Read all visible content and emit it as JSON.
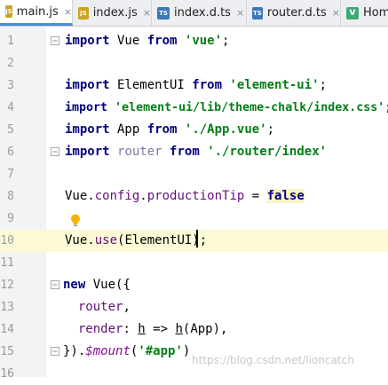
{
  "tabs": [
    {
      "label": "main.js",
      "icon": "js-file-icon",
      "badge": "JS",
      "active": true
    },
    {
      "label": "index.js",
      "icon": "js-file-icon",
      "badge": "JS",
      "active": false
    },
    {
      "label": "index.d.ts",
      "icon": "ts-file-icon",
      "badge": "TS",
      "active": false
    },
    {
      "label": "router.d.ts",
      "icon": "ts-file-icon",
      "badge": "TS",
      "active": false
    },
    {
      "label": "Hom",
      "icon": "vue-file-icon",
      "badge": "V",
      "active": false
    }
  ],
  "close_glyph": "×",
  "lines": [
    {
      "num": "1"
    },
    {
      "num": "2"
    },
    {
      "num": "3"
    },
    {
      "num": "4"
    },
    {
      "num": "5"
    },
    {
      "num": "6"
    },
    {
      "num": "7"
    },
    {
      "num": "8"
    },
    {
      "num": "9"
    },
    {
      "num": "10"
    },
    {
      "num": "11"
    },
    {
      "num": "12"
    },
    {
      "num": "13"
    },
    {
      "num": "14"
    },
    {
      "num": "15"
    },
    {
      "num": "16"
    }
  ],
  "code": {
    "l1": {
      "k1": "import",
      "t1": " Vue ",
      "k2": "from",
      "t2": " ",
      "s1": "'vue'",
      "t3": ";"
    },
    "l3": {
      "k1": "import",
      "t1": " ElementUI ",
      "k2": "from",
      "t2": " ",
      "s1": "'element-ui'",
      "t3": ";"
    },
    "l4": {
      "k1": "import",
      "t1": " ",
      "s1": "'element-ui/lib/theme-chalk/index.css'",
      "t2": ";"
    },
    "l5": {
      "k1": "import",
      "t1": " App ",
      "k2": "from",
      "t2": " ",
      "s1": "'./App.vue'",
      "t3": ";"
    },
    "l6": {
      "k1": "import",
      "t1": " ",
      "p1": "router",
      "t2": " ",
      "k2": "from",
      "t3": " ",
      "s1": "'./router/index'"
    },
    "l8": {
      "t1": "Vue.",
      "p1": "config",
      "t2": ".",
      "p2": "productionTip",
      "t3": " = ",
      "k1": "false"
    },
    "l10": {
      "t1": "Vue.",
      "p1": "use",
      "t2": "(ElementUI);"
    },
    "l12": {
      "k1": "new",
      "t1": " Vue({"
    },
    "l13": {
      "t1": "  ",
      "p1": "router",
      "t2": ","
    },
    "l14": {
      "t1": "  ",
      "p1": "render",
      "t2": ": ",
      "u1": "h",
      "t3": " => ",
      "u2": "h",
      "t4": "(App),"
    },
    "l15": {
      "t1": "}).",
      "m1": "$mount",
      "t2": "(",
      "s1": "'#app'",
      "t3": ")"
    }
  },
  "watermark": "https://blog.csdn.net/lioncatch",
  "colors": {
    "keyword": "#000080",
    "string": "#067d17",
    "property": "#660e7a",
    "current_line": "#fcfad6",
    "tab_accent": "#4a8ad8"
  }
}
